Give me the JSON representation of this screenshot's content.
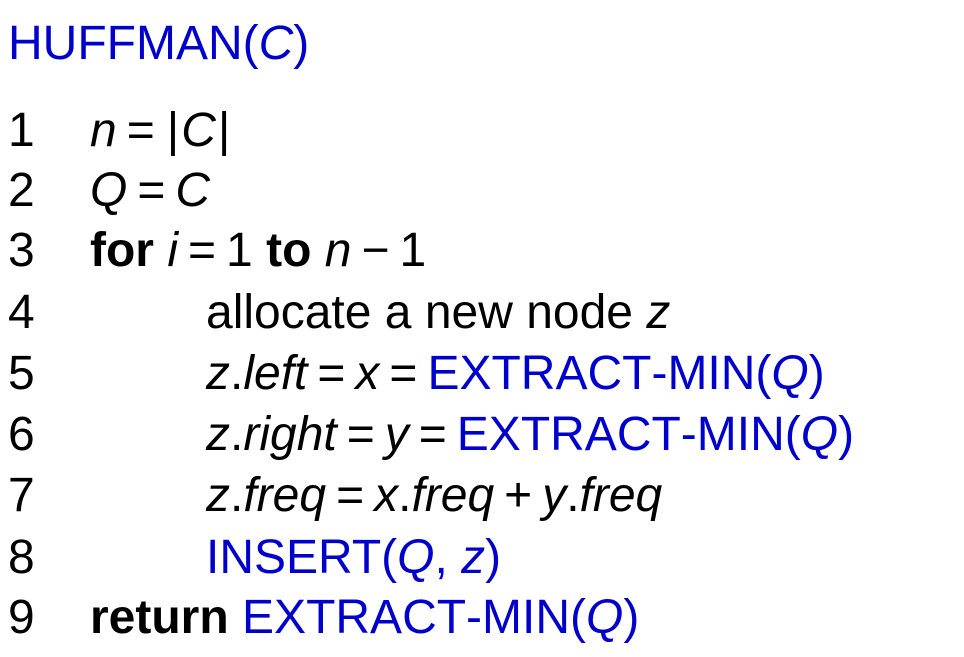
{
  "algorithm": {
    "name_first": "H",
    "name_rest": "UFFMAN",
    "param": "C",
    "lines": [
      {
        "num": "1"
      },
      {
        "num": "2"
      },
      {
        "num": "3"
      },
      {
        "num": "4"
      },
      {
        "num": "5"
      },
      {
        "num": "6"
      },
      {
        "num": "7"
      },
      {
        "num": "8"
      },
      {
        "num": "9"
      }
    ]
  },
  "tokens": {
    "n": "n",
    "C": "C",
    "Q": "Q",
    "i": "i",
    "one": "1",
    "x": "x",
    "y": "y",
    "z": "z",
    "eq": "=",
    "minus": "−",
    "plus": "+",
    "bar": "|",
    "comma": ",",
    "dot": ".",
    "lparen": "(",
    "rparen": ")",
    "for": "for",
    "to": "to",
    "return": "return",
    "allocate_text": "allocate a new node",
    "left": "left",
    "right": "right",
    "freq": "freq",
    "extract_first": "E",
    "extract_rest": "XTRACT",
    "dash": "-",
    "min_first": "M",
    "min_rest": "IN",
    "insert_first": "I",
    "insert_rest": "NSERT"
  },
  "colors": {
    "procedure": "#0000cc",
    "text": "#000000"
  }
}
